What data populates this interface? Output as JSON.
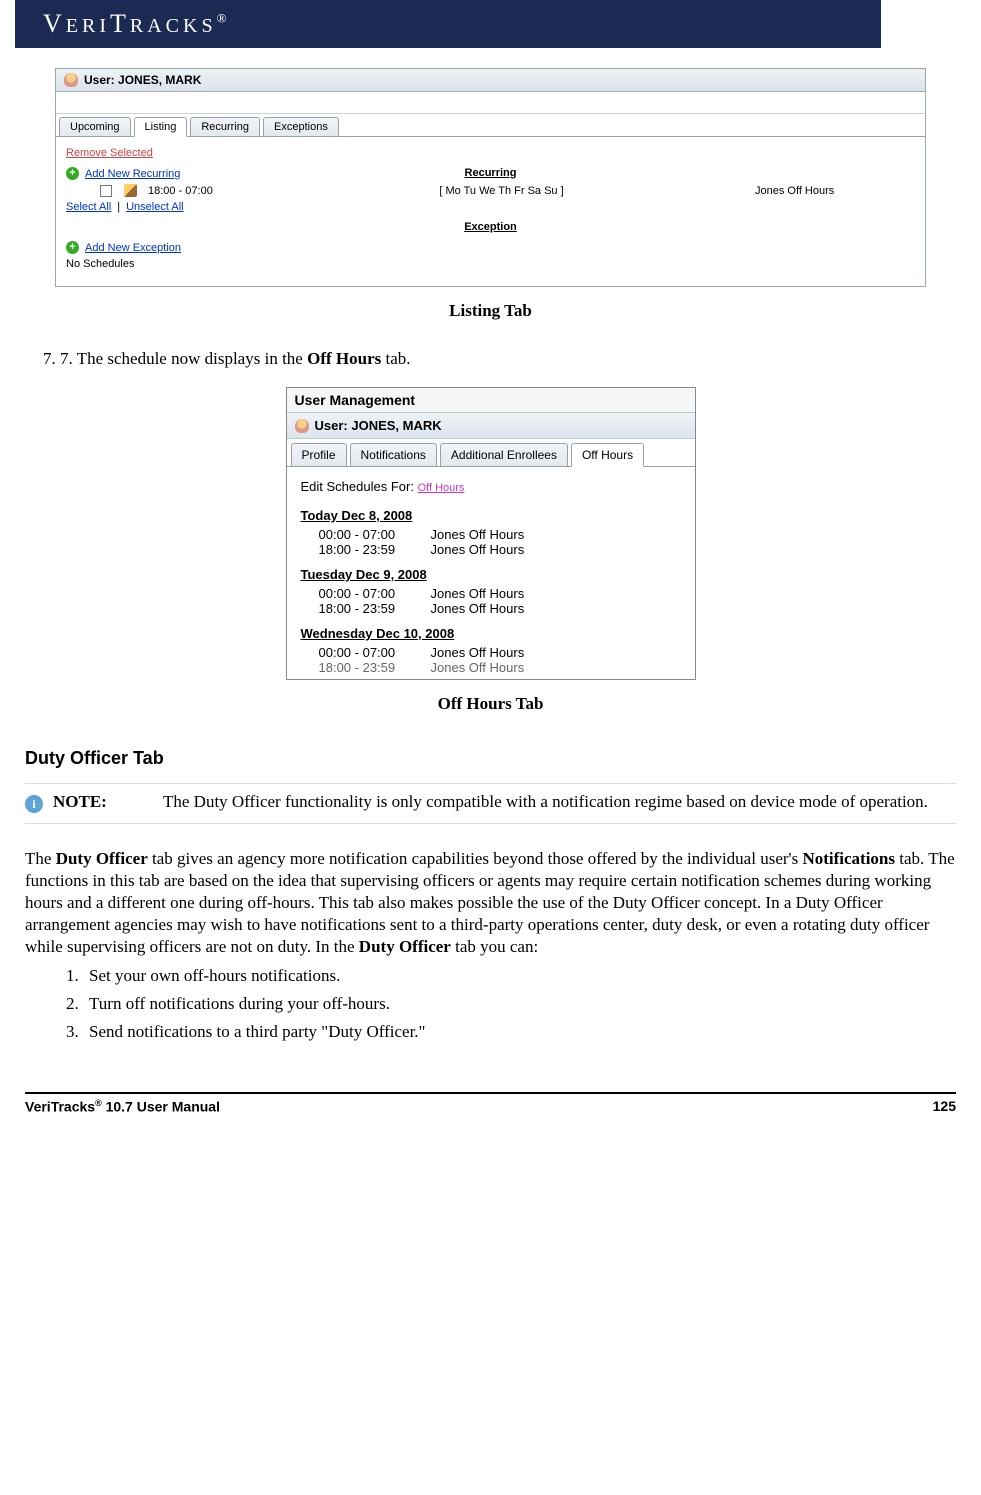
{
  "header": {
    "brand_html": "V E R I T R A C K S",
    "reg": "®"
  },
  "screenshot1": {
    "user_label": "User:",
    "user_name": "JONES, MARK",
    "tabs": [
      "Upcoming",
      "Listing",
      "Recurring",
      "Exceptions"
    ],
    "active_tab_index": 1,
    "remove_selected": "Remove Selected",
    "add_recurring": "Add New Recurring",
    "recurring_header": "Recurring",
    "row_time": "18:00 - 07:00",
    "row_days": "[ Mo Tu We Th Fr Sa Su ]",
    "row_name": "Jones Off Hours",
    "select_all": "Select All",
    "pipe": " | ",
    "unselect_all": "Unselect All",
    "exception_header": "Exception",
    "add_exception": "Add New Exception",
    "no_schedules": "No Schedules"
  },
  "caption1": "Listing Tab",
  "step7_prefix": "7.   The schedule now displays in the ",
  "step7_bold": "Off Hours",
  "step7_suffix": " tab.",
  "screenshot2": {
    "panel_title": "User Management",
    "user_label": "User: JONES, MARK",
    "tabs": [
      "Profile",
      "Notifications",
      "Additional Enrollees",
      "Off Hours"
    ],
    "active_tab_index": 3,
    "edit_label": "Edit Schedules For: ",
    "edit_link": "Off Hours",
    "days": [
      {
        "title": "Today Dec 8, 2008",
        "rows": [
          [
            "00:00 - 07:00",
            "Jones Off Hours"
          ],
          [
            "18:00 - 23:59",
            "Jones Off Hours"
          ]
        ]
      },
      {
        "title": "Tuesday Dec 9, 2008",
        "rows": [
          [
            "00:00 - 07:00",
            "Jones Off Hours"
          ],
          [
            "18:00 - 23:59",
            "Jones Off Hours"
          ]
        ]
      },
      {
        "title": "Wednesday Dec 10, 2008",
        "rows": [
          [
            "00:00 - 07:00",
            "Jones Off Hours"
          ],
          [
            "18:00 - 23:59",
            "Jones Off Hours"
          ]
        ]
      }
    ]
  },
  "caption2": "Off Hours Tab",
  "duty_heading": "Duty Officer Tab",
  "note": {
    "label": "NOTE:",
    "text": "The Duty Officer functionality is only compatible with a notification regime based on device mode of operation."
  },
  "duty_para": {
    "pre1": "The ",
    "b1": "Duty Officer",
    "mid1": " tab gives an agency more notification capabilities beyond those offered by the individual user's ",
    "b2": "Notifications",
    "mid2": " tab. The functions in this tab are based on the idea that supervising officers or agents may require certain notification schemes during working hours and a different one during off-hours. This tab also makes possible the use of the Duty Officer concept. In a Duty Officer arrangement agencies may wish to have notifications sent to a third-party operations center, duty desk, or even a rotating duty officer while supervising officers are not on duty. In the ",
    "b3": "Duty Officer",
    "post": " tab you can:"
  },
  "duty_list": [
    "Set your own off-hours notifications.",
    "Turn off notifications during your off-hours.",
    "Send notifications to a third party \"Duty Officer.\""
  ],
  "footer": {
    "left_pre": "VeriTracks",
    "left_sup": "®",
    "left_post": " 10.7 User Manual",
    "page": "125"
  }
}
